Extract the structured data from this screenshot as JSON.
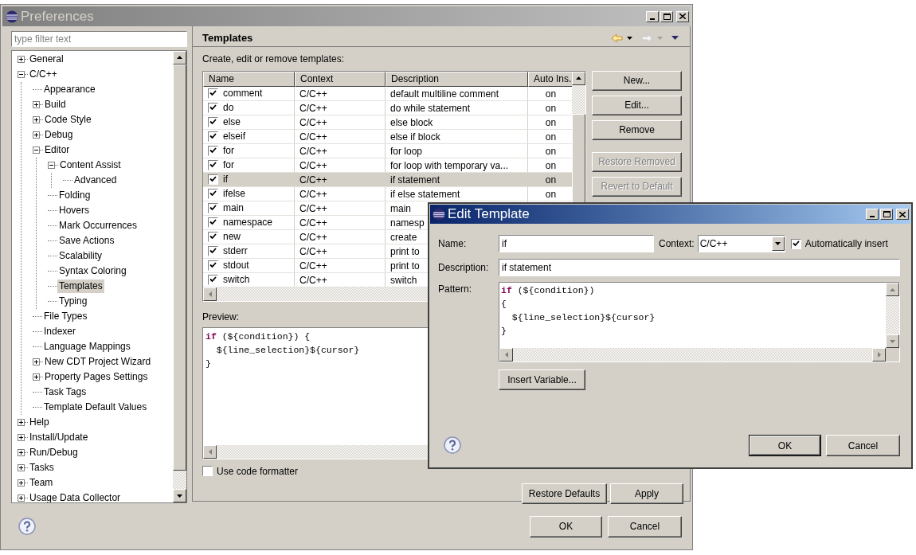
{
  "preferences_window": {
    "title": "Preferences",
    "filter": {
      "placeholder": "type filter text"
    },
    "tree": [
      {
        "label": "General",
        "kind": "node",
        "expanded": false,
        "selected": false
      },
      {
        "label": "C/C++",
        "kind": "node",
        "expanded": true,
        "selected": false,
        "children": [
          {
            "label": "Appearance",
            "kind": "leaf",
            "selected": false
          },
          {
            "label": "Build",
            "kind": "node",
            "expanded": false,
            "selected": false
          },
          {
            "label": "Code Style",
            "kind": "node",
            "expanded": false,
            "selected": false
          },
          {
            "label": "Debug",
            "kind": "node",
            "expanded": false,
            "selected": false
          },
          {
            "label": "Editor",
            "kind": "node",
            "expanded": true,
            "selected": false,
            "children": [
              {
                "label": "Content Assist",
                "kind": "node",
                "expanded": true,
                "selected": false,
                "children": [
                  {
                    "label": "Advanced",
                    "kind": "leaf",
                    "selected": false
                  }
                ]
              },
              {
                "label": "Folding",
                "kind": "leaf",
                "selected": false
              },
              {
                "label": "Hovers",
                "kind": "leaf",
                "selected": false
              },
              {
                "label": "Mark Occurrences",
                "kind": "leaf",
                "selected": false
              },
              {
                "label": "Save Actions",
                "kind": "leaf",
                "selected": false
              },
              {
                "label": "Scalability",
                "kind": "leaf",
                "selected": false
              },
              {
                "label": "Syntax Coloring",
                "kind": "leaf",
                "selected": false
              },
              {
                "label": "Templates",
                "kind": "leaf",
                "selected": true
              },
              {
                "label": "Typing",
                "kind": "leaf",
                "selected": false
              }
            ]
          },
          {
            "label": "File Types",
            "kind": "leaf",
            "selected": false
          },
          {
            "label": "Indexer",
            "kind": "leaf",
            "selected": false
          },
          {
            "label": "Language Mappings",
            "kind": "leaf",
            "selected": false
          },
          {
            "label": "New CDT Project Wizard",
            "kind": "node",
            "expanded": false,
            "selected": false
          },
          {
            "label": "Property Pages Settings",
            "kind": "node",
            "expanded": false,
            "selected": false
          },
          {
            "label": "Task Tags",
            "kind": "leaf",
            "selected": false
          },
          {
            "label": "Template Default Values",
            "kind": "leaf",
            "selected": false
          }
        ]
      },
      {
        "label": "Help",
        "kind": "node",
        "expanded": false,
        "selected": false
      },
      {
        "label": "Install/Update",
        "kind": "node",
        "expanded": false,
        "selected": false
      },
      {
        "label": "Run/Debug",
        "kind": "node",
        "expanded": false,
        "selected": false
      },
      {
        "label": "Tasks",
        "kind": "node",
        "expanded": false,
        "selected": false
      },
      {
        "label": "Team",
        "kind": "node",
        "expanded": false,
        "selected": false
      },
      {
        "label": "Usage Data Collector",
        "kind": "node",
        "expanded": false,
        "selected": false
      }
    ],
    "page_title": "Templates",
    "intro": "Create, edit or remove templates:",
    "table": {
      "columns": [
        "Name",
        "Context",
        "Description",
        "Auto Ins."
      ],
      "rows": [
        {
          "checked": true,
          "selected": false,
          "name": "comment",
          "context": "C/C++",
          "description": "default multiline comment",
          "auto_insert": "on"
        },
        {
          "checked": true,
          "selected": false,
          "name": "do",
          "context": "C/C++",
          "description": "do while statement",
          "auto_insert": "on"
        },
        {
          "checked": true,
          "selected": false,
          "name": "else",
          "context": "C/C++",
          "description": "else block",
          "auto_insert": "on"
        },
        {
          "checked": true,
          "selected": false,
          "name": "elseif",
          "context": "C/C++",
          "description": "else if block",
          "auto_insert": "on"
        },
        {
          "checked": true,
          "selected": false,
          "name": "for",
          "context": "C/C++",
          "description": "for loop",
          "auto_insert": "on"
        },
        {
          "checked": true,
          "selected": false,
          "name": "for",
          "context": "C/C++",
          "description": "for loop with temporary va...",
          "auto_insert": "on"
        },
        {
          "checked": true,
          "selected": true,
          "name": "if",
          "context": "C/C++",
          "description": "if statement",
          "auto_insert": "on"
        },
        {
          "checked": true,
          "selected": false,
          "name": "ifelse",
          "context": "C/C++",
          "description": "if else statement",
          "auto_insert": "on"
        },
        {
          "checked": true,
          "selected": false,
          "name": "main",
          "context": "C/C++",
          "description": "main"
        },
        {
          "checked": true,
          "selected": false,
          "name": "namespace",
          "context": "C/C++",
          "description": "namesp"
        },
        {
          "checked": true,
          "selected": false,
          "name": "new",
          "context": "C/C++",
          "description": "create"
        },
        {
          "checked": true,
          "selected": false,
          "name": "stderr",
          "context": "C/C++",
          "description": "print to"
        },
        {
          "checked": true,
          "selected": false,
          "name": "stdout",
          "context": "C/C++",
          "description": "print to"
        },
        {
          "checked": true,
          "selected": false,
          "name": "switch",
          "context": "C/C++",
          "description": "switch"
        }
      ]
    },
    "side_buttons": [
      {
        "label": "New...",
        "disabled": false
      },
      {
        "label": "Edit...",
        "disabled": false
      },
      {
        "label": "Remove",
        "disabled": false
      },
      {
        "label": "Restore Removed",
        "disabled": true
      },
      {
        "label": "Revert to Default",
        "disabled": true
      }
    ],
    "preview_label": "Preview:",
    "preview": [
      [
        {
          "text": "if",
          "kind": "keyword"
        },
        {
          "text": " (${condition}) {",
          "kind": "plain"
        }
      ],
      [
        {
          "text": "  ${line_selection}${cursor}",
          "kind": "plain"
        }
      ],
      [
        {
          "text": "}",
          "kind": "plain"
        }
      ]
    ],
    "use_code_formatter": {
      "label": "Use code formatter",
      "checked": false
    },
    "page_buttons": [
      "Restore Defaults",
      "Apply"
    ],
    "buttons": [
      "OK",
      "Cancel"
    ]
  },
  "edit_template_dialog": {
    "title": "Edit Template",
    "name": {
      "label": "Name:",
      "value": "if"
    },
    "context": {
      "label": "Context:",
      "value": "C/C++"
    },
    "auto_insert": {
      "label": "Automatically insert",
      "checked": true
    },
    "description": {
      "label": "Description:",
      "value": "if statement"
    },
    "pattern": {
      "label": "Pattern:",
      "lines": [
        [
          {
            "text": "if",
            "kind": "keyword"
          },
          {
            "text": " (${condition})",
            "kind": "plain"
          }
        ],
        [
          {
            "text": "{",
            "kind": "plain"
          }
        ],
        [
          {
            "text": "  ${line_selection}${cursor}",
            "kind": "plain"
          }
        ],
        [
          {
            "text": "}",
            "kind": "plain"
          }
        ]
      ]
    },
    "insert_variable": "Insert Variable...",
    "buttons": [
      "OK",
      "Cancel"
    ]
  }
}
